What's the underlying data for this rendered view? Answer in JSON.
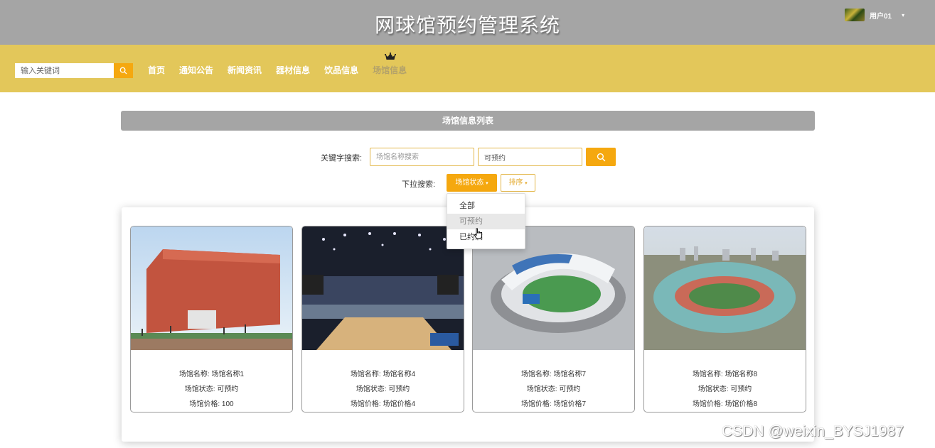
{
  "header": {
    "site_title": "网球馆预约管理系统",
    "user_name": "用户01",
    "user_caret": "▾"
  },
  "nav": {
    "search_placeholder": "输入关键词",
    "items": [
      {
        "label": "首页"
      },
      {
        "label": "通知公告"
      },
      {
        "label": "新闻资讯"
      },
      {
        "label": "器材信息"
      },
      {
        "label": "饮品信息"
      },
      {
        "label": "场馆信息",
        "active": true
      }
    ]
  },
  "section": {
    "title": "场馆信息列表"
  },
  "search": {
    "keyword_label": "关键字搜索:",
    "name_placeholder": "场馆名称搜索",
    "status_value": "可预约",
    "dropdown_label": "下拉搜索:",
    "status_button": "场馆状态",
    "sort_button": "排序"
  },
  "dropdown": {
    "items": [
      "全部",
      "可预约",
      "已约满"
    ],
    "hovered_index": 1
  },
  "cards": [
    {
      "name": "场馆名称: 场馆名称1",
      "status": "场馆状态: 可预约",
      "price": "场馆价格: 100"
    },
    {
      "name": "场馆名称: 场馆名称4",
      "status": "场馆状态: 可预约",
      "price": "场馆价格: 场馆价格4"
    },
    {
      "name": "场馆名称: 场馆名称7",
      "status": "场馆状态: 可预约",
      "price": "场馆价格: 场馆价格7"
    },
    {
      "name": "场馆名称: 场馆名称8",
      "status": "场馆状态: 可预约",
      "price": "场馆价格: 场馆价格8"
    }
  ],
  "watermark": "CSDN @weixin_BYSJ1987",
  "colors": {
    "header_bg": "#a5a5a5",
    "nav_bg": "#e3c75a",
    "accent": "#f5a80f"
  }
}
